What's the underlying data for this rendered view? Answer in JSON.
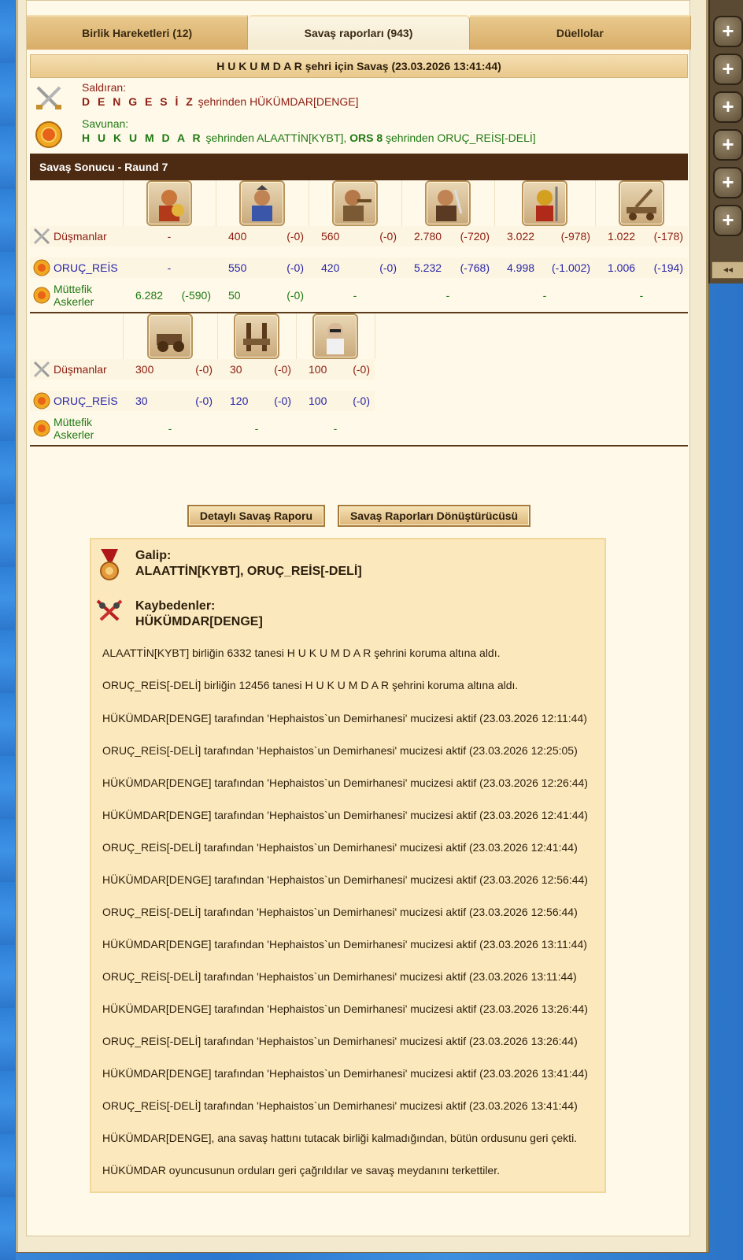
{
  "tabs": [
    {
      "label": "Birlik Hareketleri (12)",
      "active": false
    },
    {
      "label": "Savaş raporları (943)",
      "active": true
    },
    {
      "label": "Düellolar",
      "active": false
    }
  ],
  "battle": {
    "title": "H U K U M D A R şehri için Savaş (23.03.2026 13:41:44)",
    "attacker_label": "Saldıran:",
    "attacker_city": "D E N G E S İ Z",
    "attacker_text": " şehrinden HÜKÜMDAR[DENGE]",
    "defender_label": "Savunan:",
    "defender_city1": "H U K U M D A R",
    "defender_text1": " şehrinden ALAATTİN[KYBT], ",
    "defender_city2": "ORS 8",
    "defender_text2": " şehrinden ORUÇ_REİS[-DELİ]"
  },
  "result_bar": "Savaş Sonucu - Raund 7",
  "rows": {
    "enemies": "Düşmanlar",
    "own": "ORUÇ_REİS",
    "ally_line1": "Müttefik",
    "ally_line2": "Askerler"
  },
  "table1": {
    "enemies": [
      [
        "-",
        ""
      ],
      [
        "400",
        "(-0)"
      ],
      [
        "560",
        "(-0)"
      ],
      [
        "2.780",
        "(-720)"
      ],
      [
        "3.022",
        "(-978)"
      ],
      [
        "1.022",
        "(-178)"
      ]
    ],
    "own": [
      [
        "-",
        ""
      ],
      [
        "550",
        "(-0)"
      ],
      [
        "420",
        "(-0)"
      ],
      [
        "5.232",
        "(-768)"
      ],
      [
        "4.998",
        "(-1.002)"
      ],
      [
        "1.006",
        "(-194)"
      ]
    ],
    "ally": [
      [
        "6.282",
        "(-590)"
      ],
      [
        "50",
        "(-0)"
      ],
      [
        "-",
        ""
      ],
      [
        "-",
        ""
      ],
      [
        "-",
        ""
      ],
      [
        "-",
        ""
      ]
    ]
  },
  "table2": {
    "enemies": [
      [
        "300",
        "(-0)"
      ],
      [
        "30",
        "(-0)"
      ],
      [
        "100",
        "(-0)"
      ]
    ],
    "own": [
      [
        "30",
        "(-0)"
      ],
      [
        "120",
        "(-0)"
      ],
      [
        "100",
        "(-0)"
      ]
    ],
    "ally": [
      [
        "-",
        ""
      ],
      [
        "-",
        ""
      ],
      [
        "-",
        ""
      ]
    ]
  },
  "buttons": {
    "detailed": "Detaylı Savaş Raporu",
    "converter": "Savaş Raporları Dönüştürücüsü"
  },
  "summary": {
    "winner_label": "Galip:",
    "winners": "ALAATTİN[KYBT], ORUÇ_REİS[-DELİ]",
    "loser_label": "Kaybedenler:",
    "losers": "HÜKÜMDAR[DENGE]",
    "lines": [
      "ALAATTİN[KYBT] birliğin 6332 tanesi H U K U M D A R şehrini koruma altına aldı.",
      "ORUÇ_REİS[-DELİ] birliğin 12456 tanesi H U K U M D A R şehrini koruma altına aldı.",
      "HÜKÜMDAR[DENGE] tarafından 'Hephaistos`un Demirhanesi' mucizesi aktif (23.03.2026 12:11:44)",
      "ORUÇ_REİS[-DELİ] tarafından 'Hephaistos`un Demirhanesi' mucizesi aktif (23.03.2026 12:25:05)",
      "HÜKÜMDAR[DENGE] tarafından 'Hephaistos`un Demirhanesi' mucizesi aktif (23.03.2026 12:26:44)",
      "HÜKÜMDAR[DENGE] tarafından 'Hephaistos`un Demirhanesi' mucizesi aktif (23.03.2026 12:41:44)",
      "ORUÇ_REİS[-DELİ] tarafından 'Hephaistos`un Demirhanesi' mucizesi aktif (23.03.2026 12:41:44)",
      "HÜKÜMDAR[DENGE] tarafından 'Hephaistos`un Demirhanesi' mucizesi aktif (23.03.2026 12:56:44)",
      "ORUÇ_REİS[-DELİ] tarafından 'Hephaistos`un Demirhanesi' mucizesi aktif (23.03.2026 12:56:44)",
      "HÜKÜMDAR[DENGE] tarafından 'Hephaistos`un Demirhanesi' mucizesi aktif (23.03.2026 13:11:44)",
      "ORUÇ_REİS[-DELİ] tarafından 'Hephaistos`un Demirhanesi' mucizesi aktif (23.03.2026 13:11:44)",
      "HÜKÜMDAR[DENGE] tarafından 'Hephaistos`un Demirhanesi' mucizesi aktif (23.03.2026 13:26:44)",
      "ORUÇ_REİS[-DELİ] tarafından 'Hephaistos`un Demirhanesi' mucizesi aktif (23.03.2026 13:26:44)",
      "HÜKÜMDAR[DENGE] tarafından 'Hephaistos`un Demirhanesi' mucizesi aktif (23.03.2026 13:41:44)",
      "ORUÇ_REİS[-DELİ] tarafından 'Hephaistos`un Demirhanesi' mucizesi aktif (23.03.2026 13:41:44)",
      "HÜKÜMDAR[DENGE], ana savaş hattını tutacak birliği kalmadığından, bütün ordusunu geri çekti.",
      "HÜKÜMDAR oyuncusunun orduları geri çağrıldılar ve savaş meydanını terkettiler."
    ]
  },
  "sidebar": {
    "plus": "+",
    "collapse": "◂◂"
  },
  "colors": {
    "enemy": "#8d1d12",
    "own": "#2a25a8",
    "ally": "#1f7a14",
    "bar": "#4d2b12"
  }
}
